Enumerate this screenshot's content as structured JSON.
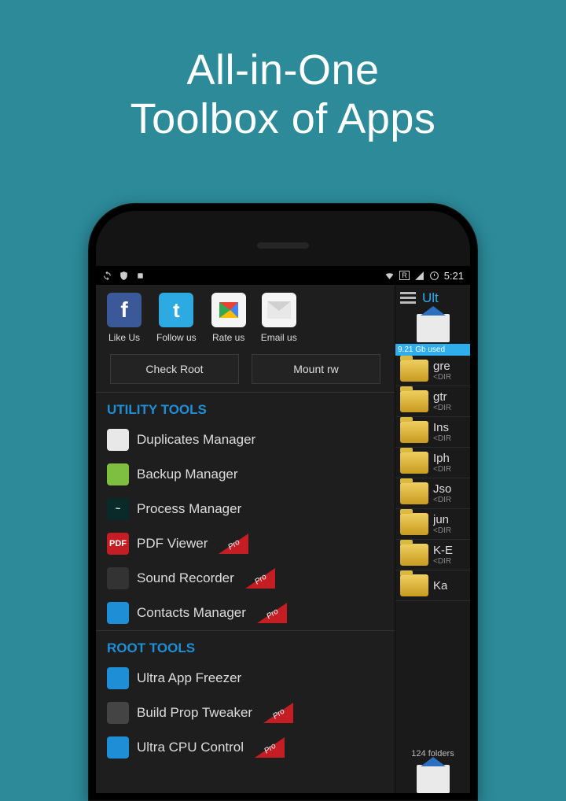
{
  "hero": {
    "line1": "All-in-One",
    "line2": "Toolbox of Apps"
  },
  "status": {
    "time": "5:21",
    "badge": "R"
  },
  "social": [
    {
      "label": "Like Us"
    },
    {
      "label": "Follow us"
    },
    {
      "label": "Rate us"
    },
    {
      "label": "Email us"
    }
  ],
  "buttons": {
    "check_root": "Check Root",
    "mount_rw": "Mount rw"
  },
  "sections": {
    "utility_title": "UTILITY TOOLS",
    "root_title": "ROOT TOOLS"
  },
  "utility_tools": [
    {
      "label": "Duplicates Manager",
      "pro": false,
      "iconBg": "#e8e8e8",
      "iconText": ""
    },
    {
      "label": "Backup Manager",
      "pro": false,
      "iconBg": "#7fbf3f",
      "iconText": ""
    },
    {
      "label": "Process Manager",
      "pro": false,
      "iconBg": "#0a2a2a",
      "iconText": "~"
    },
    {
      "label": "PDF Viewer",
      "pro": true,
      "iconBg": "#c41e24",
      "iconText": "PDF"
    },
    {
      "label": "Sound Recorder",
      "pro": true,
      "iconBg": "#333",
      "iconText": ""
    },
    {
      "label": "Contacts Manager",
      "pro": true,
      "iconBg": "#1e8fd6",
      "iconText": ""
    }
  ],
  "root_tools": [
    {
      "label": "Ultra App Freezer",
      "pro": false,
      "iconBg": "#1e8fd6",
      "iconText": ""
    },
    {
      "label": "Build Prop Tweaker",
      "pro": true,
      "iconBg": "#444",
      "iconText": ""
    },
    {
      "label": "Ultra CPU Control",
      "pro": true,
      "iconBg": "#1e8fd6",
      "iconText": ""
    }
  ],
  "right": {
    "title": "Ult",
    "storage_used": "9.21 Gb used",
    "footer": "124 folders",
    "files": [
      {
        "name": "gre",
        "meta": "<DIR"
      },
      {
        "name": "gtr",
        "meta": "<DIR"
      },
      {
        "name": "Ins",
        "meta": "<DIR"
      },
      {
        "name": "Iph",
        "meta": "<DIR"
      },
      {
        "name": "Jso",
        "meta": "<DIR"
      },
      {
        "name": "jun",
        "meta": "<DIR"
      },
      {
        "name": "K-E",
        "meta": "<DIR"
      },
      {
        "name": "Ka",
        "meta": ""
      }
    ]
  }
}
